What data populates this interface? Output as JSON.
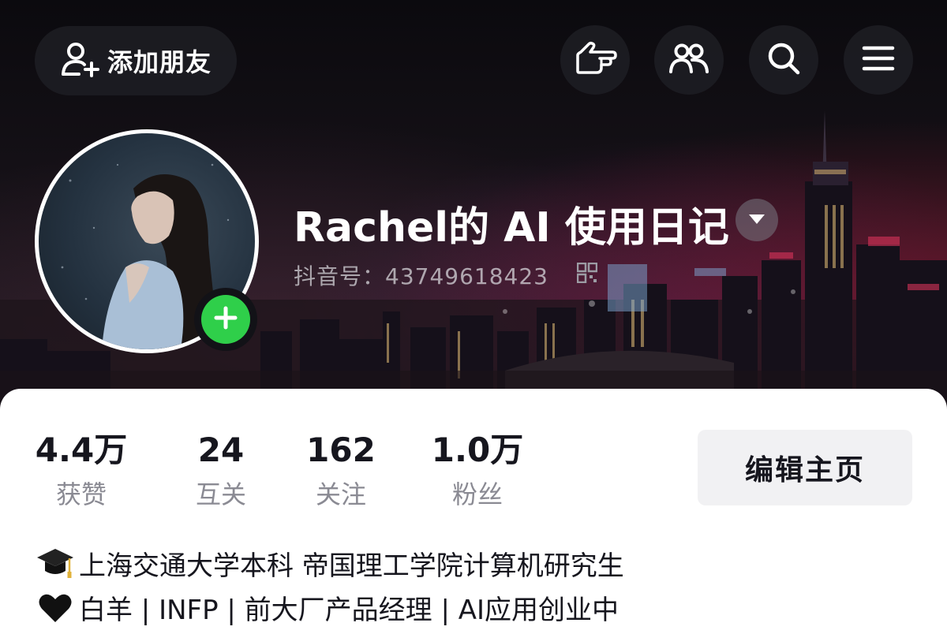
{
  "header": {
    "add_friend_label": "添加朋友",
    "icons": [
      "add-friend-icon",
      "pointing-hand-icon",
      "friends-icon",
      "search-icon",
      "menu-icon"
    ]
  },
  "profile": {
    "nickname": "Rachel的 AI 使用日记",
    "douyin_id": "抖音号：43749618423",
    "avatar_badge": "plus"
  },
  "stats": [
    {
      "value": "4.4万",
      "label": "获赞"
    },
    {
      "value": "24",
      "label": "互关"
    },
    {
      "value": "162",
      "label": "关注"
    },
    {
      "value": "1.0万",
      "label": "粉丝"
    }
  ],
  "edit_button_label": "编辑主页",
  "bio": {
    "line1_emoji": "graduation-cap-icon",
    "line1": "上海交通大学本科 帝国理工学院计算机研究生",
    "line2_emoji": "black-heart-icon",
    "line2": "白羊 | INFP | 前大厂产品经理 | AI应用创业中"
  },
  "colors": {
    "accent_green": "#2fcf4a",
    "card_bg": "#ffffff",
    "button_bg": "#f1f1f3"
  }
}
